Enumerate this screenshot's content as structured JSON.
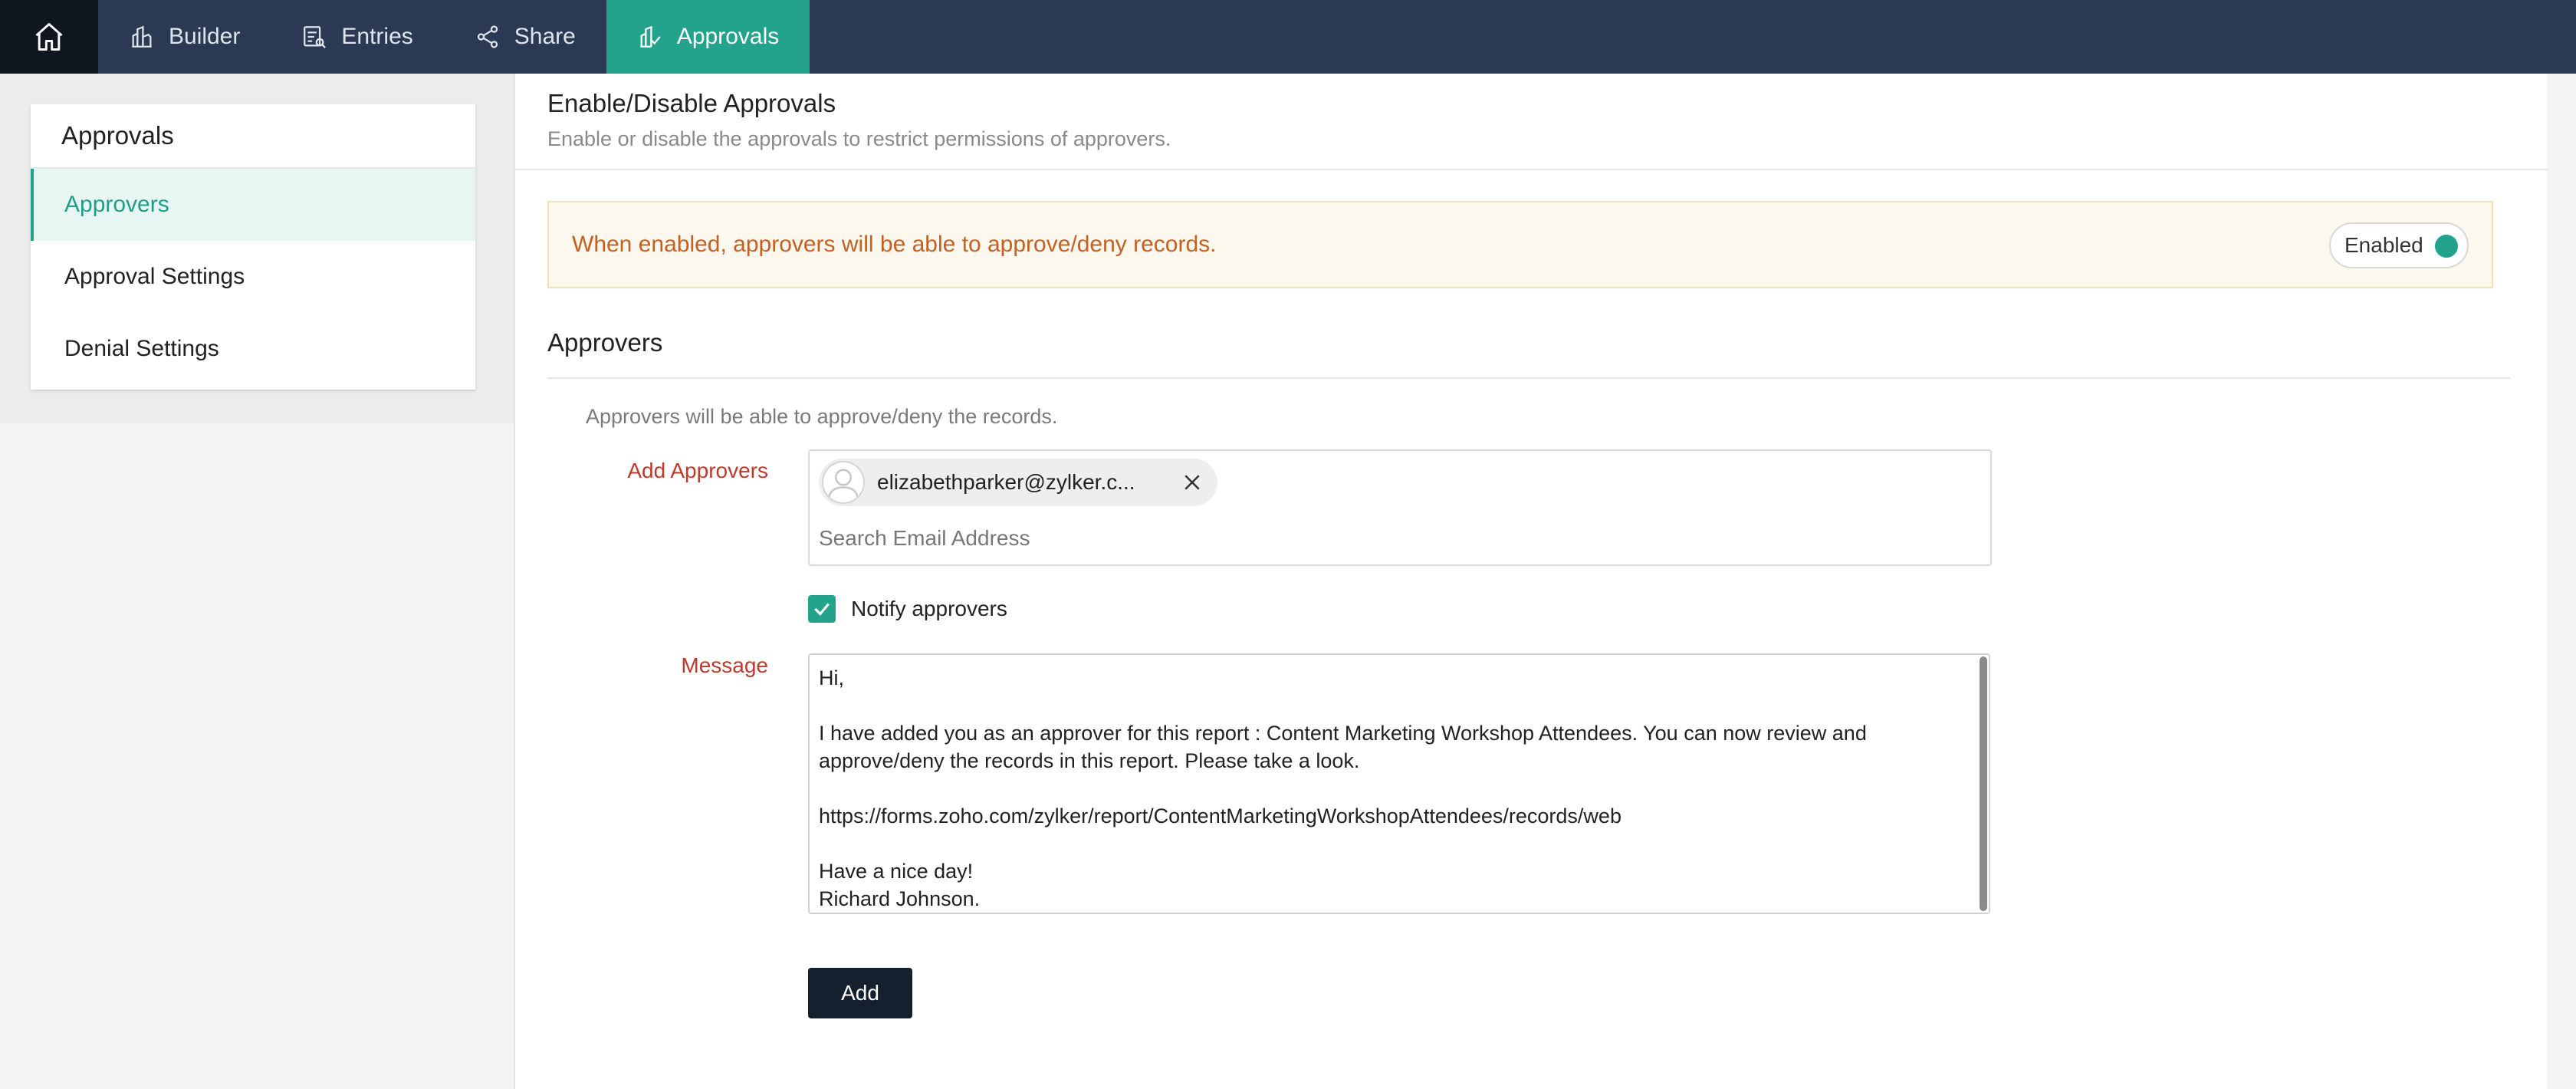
{
  "nav": {
    "home_icon": "home-icon",
    "items": [
      {
        "label": "Builder",
        "icon": "builder-icon"
      },
      {
        "label": "Entries",
        "icon": "entries-icon"
      },
      {
        "label": "Share",
        "icon": "share-icon"
      },
      {
        "label": "Approvals",
        "icon": "approvals-icon",
        "active": true
      }
    ]
  },
  "sidebar": {
    "title": "Approvals",
    "items": [
      {
        "label": "Approvers",
        "active": true
      },
      {
        "label": "Approval Settings"
      },
      {
        "label": "Denial Settings"
      }
    ]
  },
  "header": {
    "title": "Enable/Disable Approvals",
    "subtitle": "Enable or disable the approvals to restrict permissions of approvers."
  },
  "notice": {
    "text": "When enabled, approvers will be able to approve/deny records.",
    "toggle_label": "Enabled",
    "toggle_on": true
  },
  "approvers": {
    "section_title": "Approvers",
    "section_sub": "Approvers will be able to approve/deny the records.",
    "add_label": "Add Approvers",
    "chip_email": "elizabethparker@zylker.c...",
    "search_placeholder": "Search Email Address",
    "notify_label": "Notify approvers",
    "notify_checked": true,
    "message_label": "Message",
    "message": "Hi,\n\nI have added you as an approver for this report : Content Marketing Workshop Attendees. You can now review and approve/deny the records in this report. Please take a look.\n\nhttps://forms.zoho.com/zylker/report/ContentMarketingWorkshopAttendees/records/web\n\nHave a nice day!\nRichard Johnson.",
    "add_button": "Add"
  },
  "colors": {
    "accent": "#23a38c",
    "nav_bg": "#2b3a52",
    "notice_text": "#c65f22",
    "label_red": "#c0392b"
  }
}
